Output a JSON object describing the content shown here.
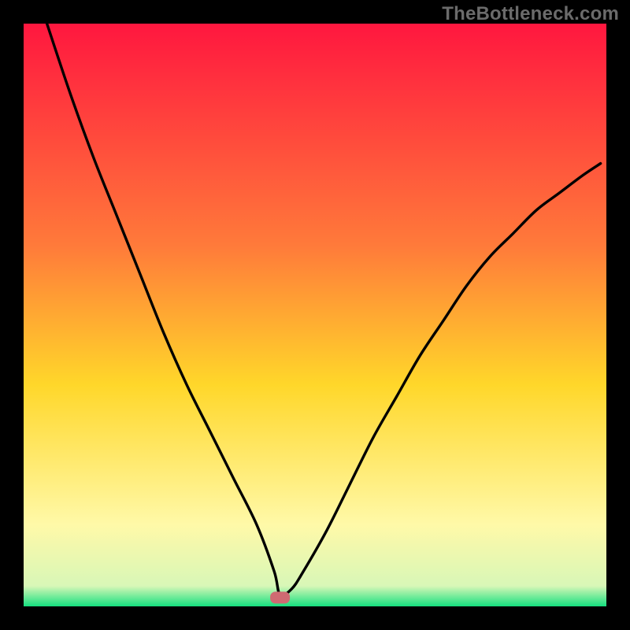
{
  "watermark": "TheBottleneck.com",
  "colors": {
    "frame": "#000000",
    "curve": "#000000",
    "marker_fill": "#cf6a72",
    "marker_stroke": "#cf6a72",
    "gradient_top": "#ff173f",
    "gradient_mid_upper": "#ff8040",
    "gradient_mid": "#ffd22a",
    "gradient_mid_lower": "#fff9b0",
    "gradient_bottom": "#15e07f",
    "watermark": "#6b6b6b"
  },
  "chart_data": {
    "type": "line",
    "title": "",
    "xlabel": "",
    "ylabel": "",
    "xlim": [
      0,
      100
    ],
    "ylim": [
      0,
      100
    ],
    "grid": false,
    "legend": false,
    "note": "Bottleneck-style V curve over vertical red→yellow→green gradient. Values estimated visually; axes have no tick labels.",
    "series": [
      {
        "name": "curve",
        "x": [
          4,
          8,
          12,
          16,
          20,
          24,
          28,
          32,
          36,
          40,
          43,
          44,
          46,
          48,
          52,
          56,
          60,
          64,
          68,
          72,
          76,
          80,
          84,
          88,
          92,
          96,
          99
        ],
        "y": [
          100,
          88,
          77,
          67,
          57,
          47,
          38,
          30,
          22,
          14,
          6,
          2,
          3,
          6,
          13,
          21,
          29,
          36,
          43,
          49,
          55,
          60,
          64,
          68,
          71,
          74,
          76
        ]
      }
    ],
    "marker": {
      "name": "optimum-marker",
      "x": 44,
      "y": 1.5,
      "shape": "rounded-rect"
    },
    "background_gradient": {
      "direction": "top-to-bottom",
      "stops": [
        {
          "offset": 0.0,
          "color": "#ff173f"
        },
        {
          "offset": 0.38,
          "color": "#ff7a3a"
        },
        {
          "offset": 0.62,
          "color": "#ffd72a"
        },
        {
          "offset": 0.86,
          "color": "#fff9a8"
        },
        {
          "offset": 0.965,
          "color": "#d8f7b7"
        },
        {
          "offset": 1.0,
          "color": "#15e07f"
        }
      ]
    }
  }
}
